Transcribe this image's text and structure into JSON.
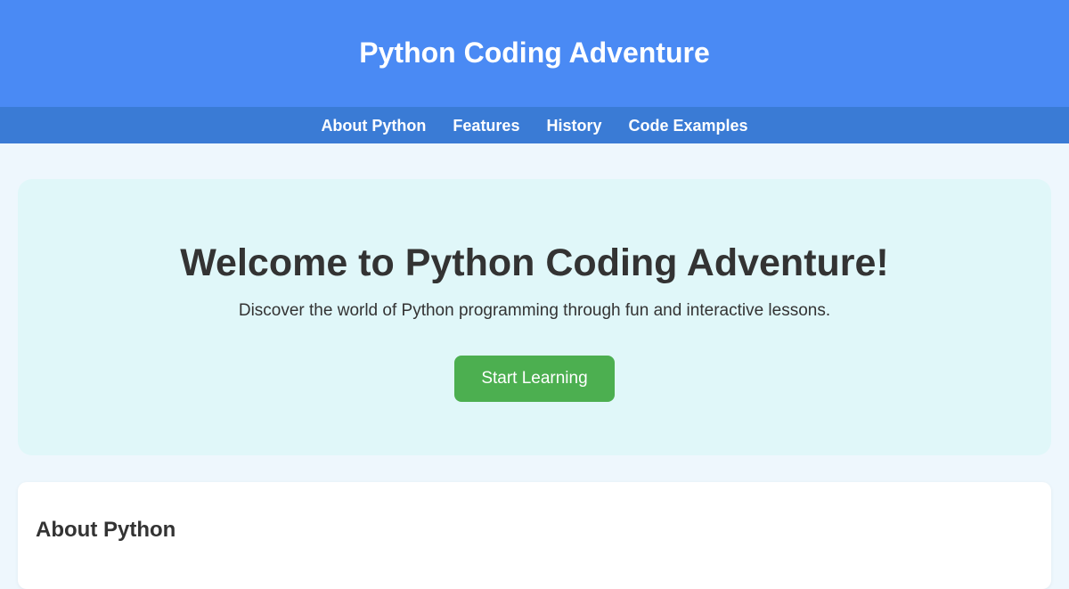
{
  "header": {
    "title": "Python Coding Adventure"
  },
  "nav": {
    "items": [
      {
        "label": "About Python"
      },
      {
        "label": "Features"
      },
      {
        "label": "History"
      },
      {
        "label": "Code Examples"
      }
    ]
  },
  "hero": {
    "title": "Welcome to Python Coding Adventure!",
    "subtitle": "Discover the world of Python programming through fun and interactive lessons.",
    "cta_label": "Start Learning"
  },
  "about": {
    "title": "About Python"
  },
  "colors": {
    "header_bg": "#4a8af4",
    "nav_bg": "#3a7bd5",
    "page_bg": "#eef7fd",
    "hero_bg": "#e0f7f9",
    "cta_bg": "#4caf50",
    "text": "#333333"
  }
}
